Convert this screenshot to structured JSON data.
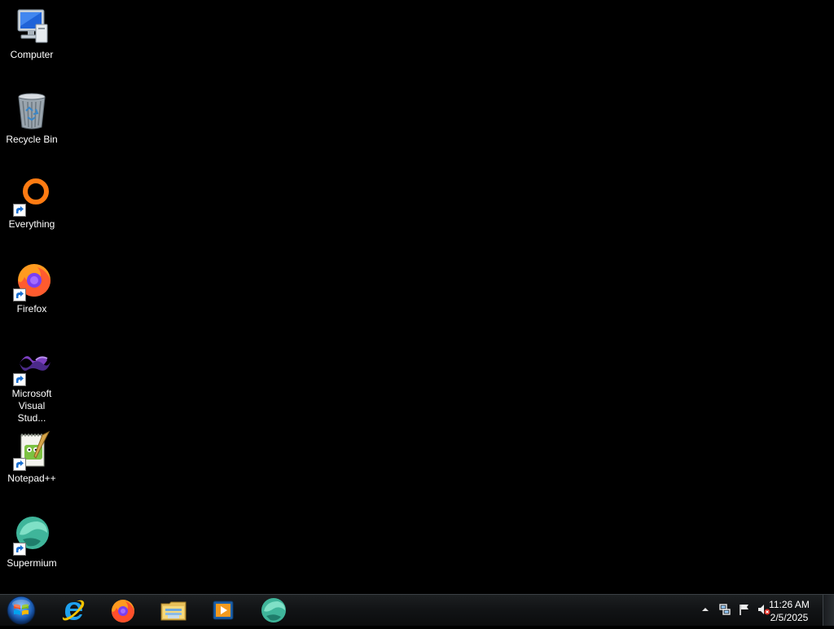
{
  "desktop": {
    "icons": [
      {
        "label": "Computer",
        "icon": "computer-icon",
        "shortcut": false
      },
      {
        "label": "Recycle Bin",
        "icon": "recycle-bin-icon",
        "shortcut": false
      },
      {
        "label": "Everything",
        "icon": "everything-icon",
        "shortcut": true
      },
      {
        "label": "Firefox",
        "icon": "firefox-icon",
        "shortcut": true
      },
      {
        "label": "Microsoft Visual Stud...",
        "icon": "visual-studio-icon",
        "shortcut": true
      },
      {
        "label": "Notepad++",
        "icon": "notepad-plus-plus-icon",
        "shortcut": true
      },
      {
        "label": "Supermium",
        "icon": "supermium-icon",
        "shortcut": true
      }
    ]
  },
  "taskbar": {
    "start": {
      "icon": "windows-start-orb-icon"
    },
    "pinned": [
      {
        "icon": "internet-explorer-icon"
      },
      {
        "icon": "firefox-icon"
      },
      {
        "icon": "file-explorer-icon"
      },
      {
        "icon": "media-player-icon"
      },
      {
        "icon": "supermium-icon"
      }
    ],
    "tray": {
      "icons": [
        "show-hidden-icons-arrow",
        "network-icon",
        "action-center-flag-icon",
        "volume-muted-icon"
      ],
      "time": "11:26 AM",
      "date": "2/5/2025"
    }
  },
  "colors": {
    "desktop_background": "#000000",
    "taskbar": "#121416",
    "text": "#ffffff"
  }
}
